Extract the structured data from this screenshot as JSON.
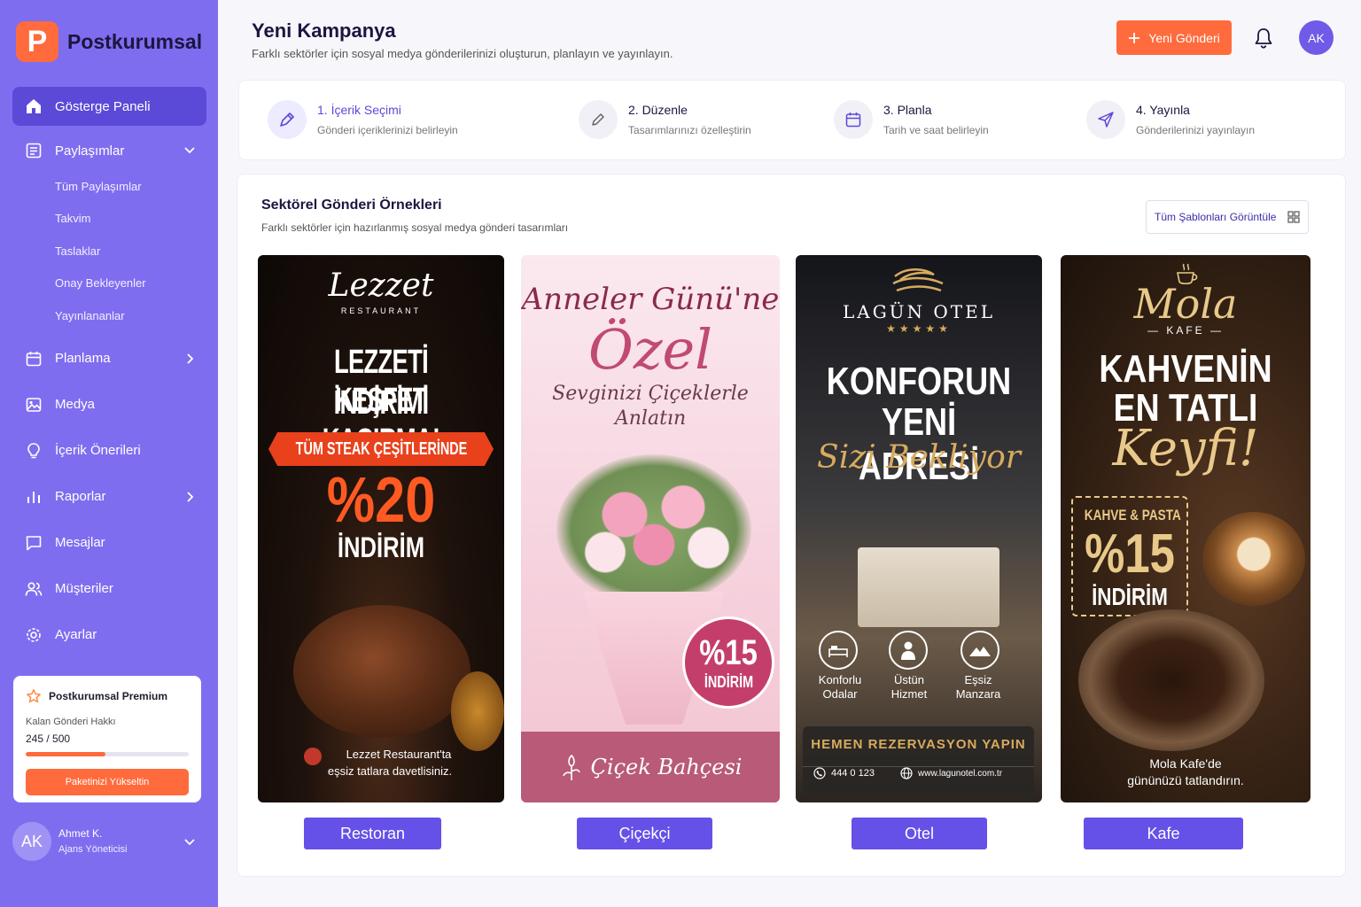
{
  "brand": {
    "logo_letter": "P",
    "name": "Postkurumsal"
  },
  "sidebar": {
    "items": [
      {
        "label": "Gösterge Paneli",
        "icon": "home-icon",
        "active": true
      },
      {
        "label": "Paylaşımlar",
        "icon": "document-icon",
        "expanded": true
      },
      {
        "label": "Planlama",
        "icon": "calendar-icon"
      },
      {
        "label": "Medya",
        "icon": "image-icon"
      },
      {
        "label": "İçerik Önerileri",
        "icon": "lightbulb-icon"
      },
      {
        "label": "Raporlar",
        "icon": "bar-chart-icon"
      },
      {
        "label": "Mesajlar",
        "icon": "message-icon"
      },
      {
        "label": "Müşteriler",
        "icon": "users-icon"
      },
      {
        "label": "Ayarlar",
        "icon": "gear-icon"
      }
    ],
    "subitems": [
      "Tüm Paylaşımlar",
      "Takvim",
      "Taslaklar",
      "Onay Bekleyenler",
      "Yayınlananlar"
    ]
  },
  "premium": {
    "title": "Postkurumsal Premium",
    "label": "Kalan Gönderi Hakkı",
    "used": "245",
    "total": "500",
    "count": "245 / 500",
    "button": "Paketinizi Yükseltin"
  },
  "user": {
    "initials": "AK",
    "name": "Ahmet K.",
    "role": "Ajans Yöneticisi"
  },
  "header": {
    "title": "Yeni Kampanya",
    "subtitle": "Farklı sektörler için sosyal medya gönderilerinizi oluşturun, planlayın ve yayınlayın.",
    "new_post": "Yeni Gönderi",
    "avatar": "AK"
  },
  "steps": [
    {
      "title": "1. İçerik Seçimi",
      "desc": "Gönderi içeriklerinizi belirleyin",
      "icon": "pen-tool-icon",
      "active": true
    },
    {
      "title": "2. Düzenle",
      "desc": "Tasarımlarınızı özelleştirin",
      "icon": "pencil-icon"
    },
    {
      "title": "3. Planla",
      "desc": "Tarih ve saat belirleyin",
      "icon": "calendar-icon"
    },
    {
      "title": "4. Yayınla",
      "desc": "Gönderilerinizi yayınlayın",
      "icon": "send-icon"
    }
  ],
  "panel": {
    "title": "Sektörel Gönderi Örnekleri",
    "subtitle": "Farklı sektörler için hazırlanmış sosyal medya gönderi tasarımları",
    "templates_button": "Tüm Şablonları Görüntüle"
  },
  "cards": {
    "restaurant": {
      "brand": "Lezzet",
      "brand_sub": "RESTAURANT",
      "headline1": "LEZZETİ KEŞFET",
      "headline2": "İNDİRİMİ KAÇIRMA!",
      "ribbon": "TÜM STEAK ÇEŞİTLERİNDE",
      "discount": "%20",
      "discount_label": "İNDİRİM",
      "footer1": "Lezzet Restaurant'ta",
      "footer2": "eşsiz tatlara davetlisiniz.",
      "sector": "Restoran"
    },
    "florist": {
      "title1": "Anneler Günü'ne",
      "title2": "Özel",
      "tag1": "Sevginizi Çiçeklerle",
      "tag2": "Anlatın",
      "discount": "%15",
      "discount_label": "İNDİRİM",
      "shop": "Çiçek Bahçesi",
      "sector": "Çiçekçi"
    },
    "hotel": {
      "brand": "LAGÜN OTEL",
      "stars": "★★★★★",
      "headline1": "KONFORUN",
      "headline2": "YENİ ADRESİ",
      "script": "Sizi Bekliyor",
      "features": [
        {
          "l1": "Konforlu",
          "l2": "Odalar",
          "icon": "bed-icon"
        },
        {
          "l1": "Üstün",
          "l2": "Hizmet",
          "icon": "bellboy-icon"
        },
        {
          "l1": "Eşsiz",
          "l2": "Manzara",
          "icon": "mountain-icon"
        }
      ],
      "cta": "HEMEN REZERVASYON YAPIN",
      "phone": "444 0 123",
      "web": "www.lagunotel.com.tr",
      "sector": "Otel"
    },
    "cafe": {
      "brand": "Mola",
      "brand_sub": "— KAFE —",
      "headline1": "KAHVENİN",
      "headline2": "EN TATLI",
      "script": "Keyfi!",
      "box_title": "KAHVE & PASTA",
      "discount": "%15",
      "discount_label": "İNDİRİM",
      "footer1": "Mola Kafe'de",
      "footer2": "gününüzü tatlandırın.",
      "sector": "Kafe"
    }
  },
  "colors": {
    "sidebar": "#7f6df0",
    "accent": "#ff6b3d",
    "primary": "#6550e8"
  }
}
